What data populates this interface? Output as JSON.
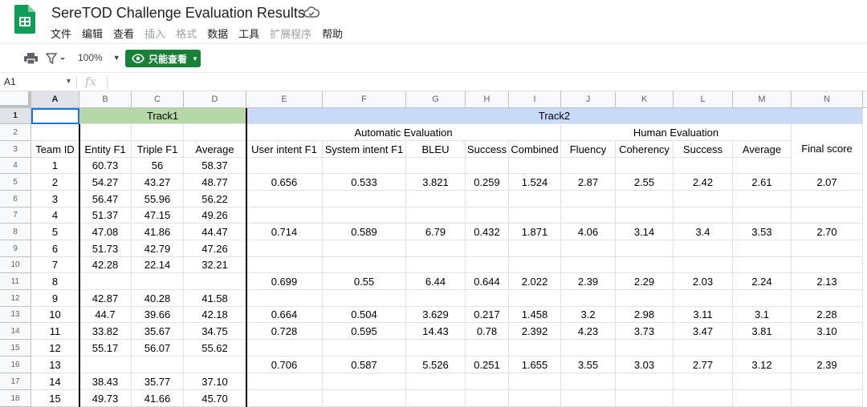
{
  "title_bar": {
    "doc_title": "SereTOD Challenge Evaluation Results",
    "menu": [
      {
        "label": "文件",
        "disabled": false
      },
      {
        "label": "编辑",
        "disabled": false
      },
      {
        "label": "查看",
        "disabled": false
      },
      {
        "label": "插入",
        "disabled": true
      },
      {
        "label": "格式",
        "disabled": true
      },
      {
        "label": "数据",
        "disabled": false
      },
      {
        "label": "工具",
        "disabled": false
      },
      {
        "label": "扩展程序",
        "disabled": true
      },
      {
        "label": "帮助",
        "disabled": false
      }
    ]
  },
  "toolbar": {
    "zoom": "100%",
    "view_only_label": "只能查看"
  },
  "formula_bar": {
    "cell_ref": "A1",
    "fx": "fx"
  },
  "grid": {
    "columns": [
      "A",
      "B",
      "C",
      "D",
      "E",
      "F",
      "G",
      "H",
      "I",
      "J",
      "K",
      "L",
      "M",
      "N"
    ],
    "active_column": "A",
    "active_row": "1",
    "rows": [
      "1",
      "2",
      "3",
      "4",
      "5",
      "6",
      "7",
      "8",
      "9",
      "10",
      "11",
      "12",
      "13",
      "14",
      "15",
      "16",
      "17",
      "18"
    ],
    "row1": {
      "track1": "Track1",
      "track2": "Track2"
    },
    "row2": {
      "automatic": "Automatic Evaluation",
      "human": "Human Evaluation",
      "final": "Final score"
    },
    "headers": [
      "Team ID",
      "Entity F1",
      "Triple F1",
      "Average",
      "User intent F1",
      "System intent F1",
      "BLEU",
      "Success",
      "Combined",
      "Fluency",
      "Coherency",
      "Success",
      "Average"
    ],
    "data_rows": [
      [
        "1",
        "60.73",
        "56",
        "58.37",
        "",
        "",
        "",
        "",
        "",
        "",
        "",
        "",
        "",
        ""
      ],
      [
        "2",
        "54.27",
        "43.27",
        "48.77",
        "0.656",
        "0.533",
        "3.821",
        "0.259",
        "1.524",
        "2.87",
        "2.55",
        "2.42",
        "2.61",
        "2.07"
      ],
      [
        "3",
        "56.47",
        "55.96",
        "56.22",
        "",
        "",
        "",
        "",
        "",
        "",
        "",
        "",
        "",
        ""
      ],
      [
        "4",
        "51.37",
        "47.15",
        "49.26",
        "",
        "",
        "",
        "",
        "",
        "",
        "",
        "",
        "",
        ""
      ],
      [
        "5",
        "47.08",
        "41.86",
        "44.47",
        "0.714",
        "0.589",
        "6.79",
        "0.432",
        "1.871",
        "4.06",
        "3.14",
        "3.4",
        "3.53",
        "2.70"
      ],
      [
        "6",
        "51.73",
        "42.79",
        "47.26",
        "",
        "",
        "",
        "",
        "",
        "",
        "",
        "",
        "",
        ""
      ],
      [
        "7",
        "42.28",
        "22.14",
        "32.21",
        "",
        "",
        "",
        "",
        "",
        "",
        "",
        "",
        "",
        ""
      ],
      [
        "8",
        "",
        "",
        "",
        "0.699",
        "0.55",
        "6.44",
        "0.644",
        "2.022",
        "2.39",
        "2.29",
        "2.03",
        "2.24",
        "2.13"
      ],
      [
        "9",
        "42.87",
        "40.28",
        "41.58",
        "",
        "",
        "",
        "",
        "",
        "",
        "",
        "",
        "",
        ""
      ],
      [
        "10",
        "44.7",
        "39.66",
        "42.18",
        "0.664",
        "0.504",
        "3.629",
        "0.217",
        "1.458",
        "3.2",
        "2.98",
        "3.11",
        "3.1",
        "2.28"
      ],
      [
        "11",
        "33.82",
        "35.67",
        "34.75",
        "0.728",
        "0.595",
        "14.43",
        "0.78",
        "2.392",
        "4.23",
        "3.73",
        "3.47",
        "3.81",
        "3.10"
      ],
      [
        "12",
        "55.17",
        "56.07",
        "55.62",
        "",
        "",
        "",
        "",
        "",
        "",
        "",
        "",
        "",
        ""
      ],
      [
        "13",
        "",
        "",
        "",
        "0.706",
        "0.587",
        "5.526",
        "0.251",
        "1.655",
        "3.55",
        "3.03",
        "2.77",
        "3.12",
        "2.39"
      ],
      [
        "14",
        "38.43",
        "35.77",
        "37.10",
        "",
        "",
        "",
        "",
        "",
        "",
        "",
        "",
        "",
        ""
      ],
      [
        "15",
        "49.73",
        "41.66",
        "45.70",
        "",
        "",
        "",
        "",
        "",
        "",
        "",
        "",
        "",
        ""
      ]
    ]
  },
  "colors": {
    "track1_fill": "#b6d7a8",
    "track2_fill": "#c9daf8",
    "view_only_button": "#188038",
    "selection": "#1a73e8"
  }
}
